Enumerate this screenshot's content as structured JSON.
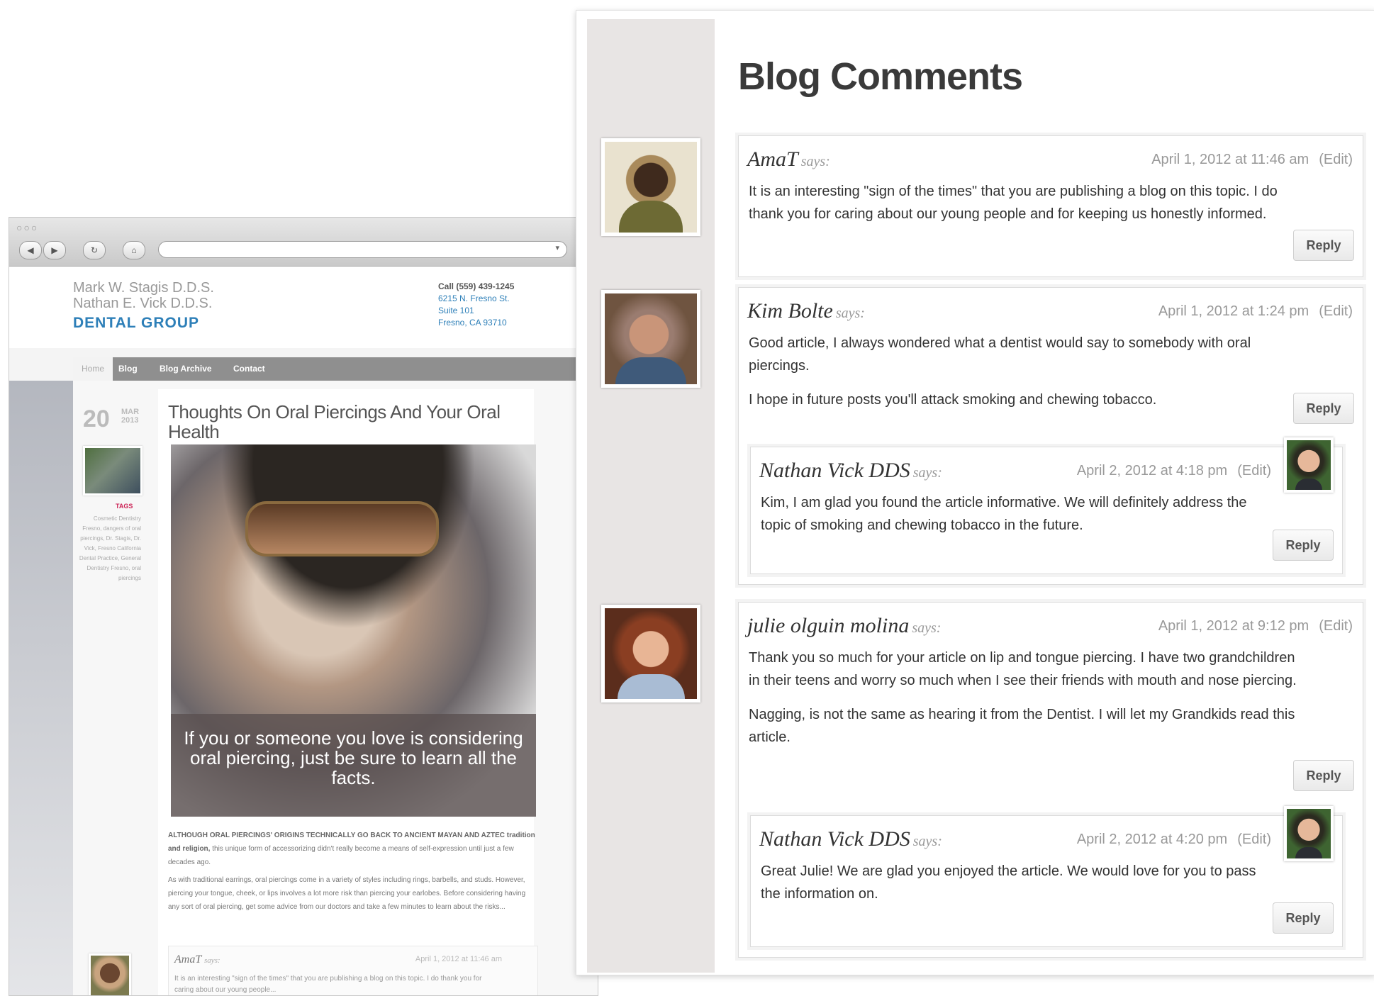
{
  "browser": {
    "lights": "○○○",
    "back_icon": "◀",
    "forward_icon": "▶",
    "reload_icon": "↻",
    "home_icon": "⌂",
    "url_dropdown_icon": "▾"
  },
  "site": {
    "doctor1": "Mark W. Stagis D.D.S.",
    "doctor2": "Nathan E. Vick D.D.S.",
    "group": "DENTAL GROUP",
    "call": "Call (559) 439-1245",
    "address1": "6215 N. Fresno St.",
    "address2": "Suite 101",
    "address3": "Fresno, CA 93710",
    "nav": [
      "Home",
      "Blog",
      "Blog Archive",
      "Contact"
    ],
    "date_day": "20",
    "date_month": "MAR",
    "date_year": "2013",
    "tags_label": "TAGS",
    "tags_text": "Cosmetic Dentistry Fresno, dangers of oral piercings, Dr. Stagis, Dr. Vick, Fresno California Dental Practice, General Dentistry Fresno, oral piercings",
    "post_title": "Thoughts On Oral Piercings And Your Oral Health",
    "image_caption": "If you or someone you love is considering oral piercing, just be sure to learn all the facts.",
    "para1_lead": "ALTHOUGH ORAL PIERCINGS' ORIGINS TECHNICALLY GO BACK TO ANCIENT MAYAN AND AZTEC tradition and religion,",
    "para1_rest": " this unique form of accessorizing didn't really become a means of self-expression until just a few decades ago.",
    "para2": "As with traditional earrings, oral piercings come in a variety of styles including rings, barbells, and studs. However, piercing your tongue, cheek, or lips involves a lot more risk than piercing your earlobes. Before considering having any sort of oral piercing, get some advice from our doctors and take a few minutes to learn about the risks...",
    "mini_comment": {
      "name": "AmaT",
      "says": "says:",
      "date": "April 1, 2012 at 11:46 am",
      "text": "It is an interesting \"sign of the times\" that you are publishing a blog on this topic. I do thank you for caring about our young people..."
    }
  },
  "panel": {
    "title": "Blog Comments",
    "says": "says:",
    "edit": "(Edit)",
    "reply": "Reply",
    "comments": [
      {
        "name": "AmaT",
        "date": "April 1, 2012 at 11:46 am",
        "paragraphs": [
          "It is an interesting \"sign of the times\" that you are publishing a blog on this topic. I do thank you for caring about our young people and for keeping us honestly informed."
        ]
      },
      {
        "name": "Kim Bolte",
        "date": "April 1, 2012 at 1:24 pm",
        "paragraphs": [
          "Good article, I always wondered what a dentist would say to somebody with oral piercings.",
          "I hope in future posts you'll attack smoking and chewing tobacco."
        ],
        "reply_comment": {
          "name": "Nathan Vick DDS",
          "date": "April 2, 2012 at 4:18 pm",
          "paragraphs": [
            "Kim, I am glad you found the article informative. We will definitely address the topic of smoking and chewing tobacco in the future."
          ]
        }
      },
      {
        "name": "julie olguin molina",
        "date": "April 1, 2012 at 9:12 pm",
        "paragraphs": [
          "Thank you so much for your article on lip and tongue piercing. I have two grandchildren in their teens and worry so much when I see their friends with mouth and nose piercing.",
          "Nagging, is not the same as hearing it from the Dentist. I will let my Grandkids read this article."
        ],
        "reply_comment": {
          "name": "Nathan Vick DDS",
          "date": "April 2, 2012 at 4:20 pm",
          "paragraphs": [
            "Great Julie! We are glad you enjoyed the article. We would love for you to pass the information on."
          ]
        }
      }
    ]
  }
}
